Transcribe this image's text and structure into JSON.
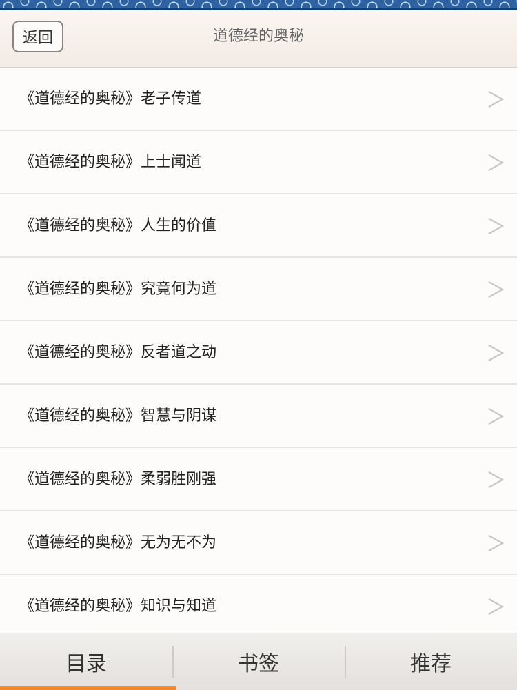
{
  "header": {
    "back_label": "返回",
    "title": "道德经的奥秘"
  },
  "list": {
    "items": [
      "《道德经的奥秘》老子传道",
      "《道德经的奥秘》上士闻道",
      "《道德经的奥秘》人生的价值",
      "《道德经的奥秘》究竟何为道",
      "《道德经的奥秘》反者道之动",
      "《道德经的奥秘》智慧与阴谋",
      "《道德经的奥秘》柔弱胜刚强",
      "《道德经的奥秘》无为无不为",
      "《道德经的奥秘》知识与知道"
    ],
    "chevron_icon": "chevron-right-icon"
  },
  "tabs": {
    "items": [
      "目录",
      "书签",
      "推荐"
    ],
    "active_index": 0,
    "active_color": "#f08a2c"
  },
  "colors": {
    "pattern_blue": "#2f62a3",
    "pattern_dark": "#0f3f7d",
    "header_bg": "#f6efe8",
    "divider": "#e8e5e2"
  }
}
